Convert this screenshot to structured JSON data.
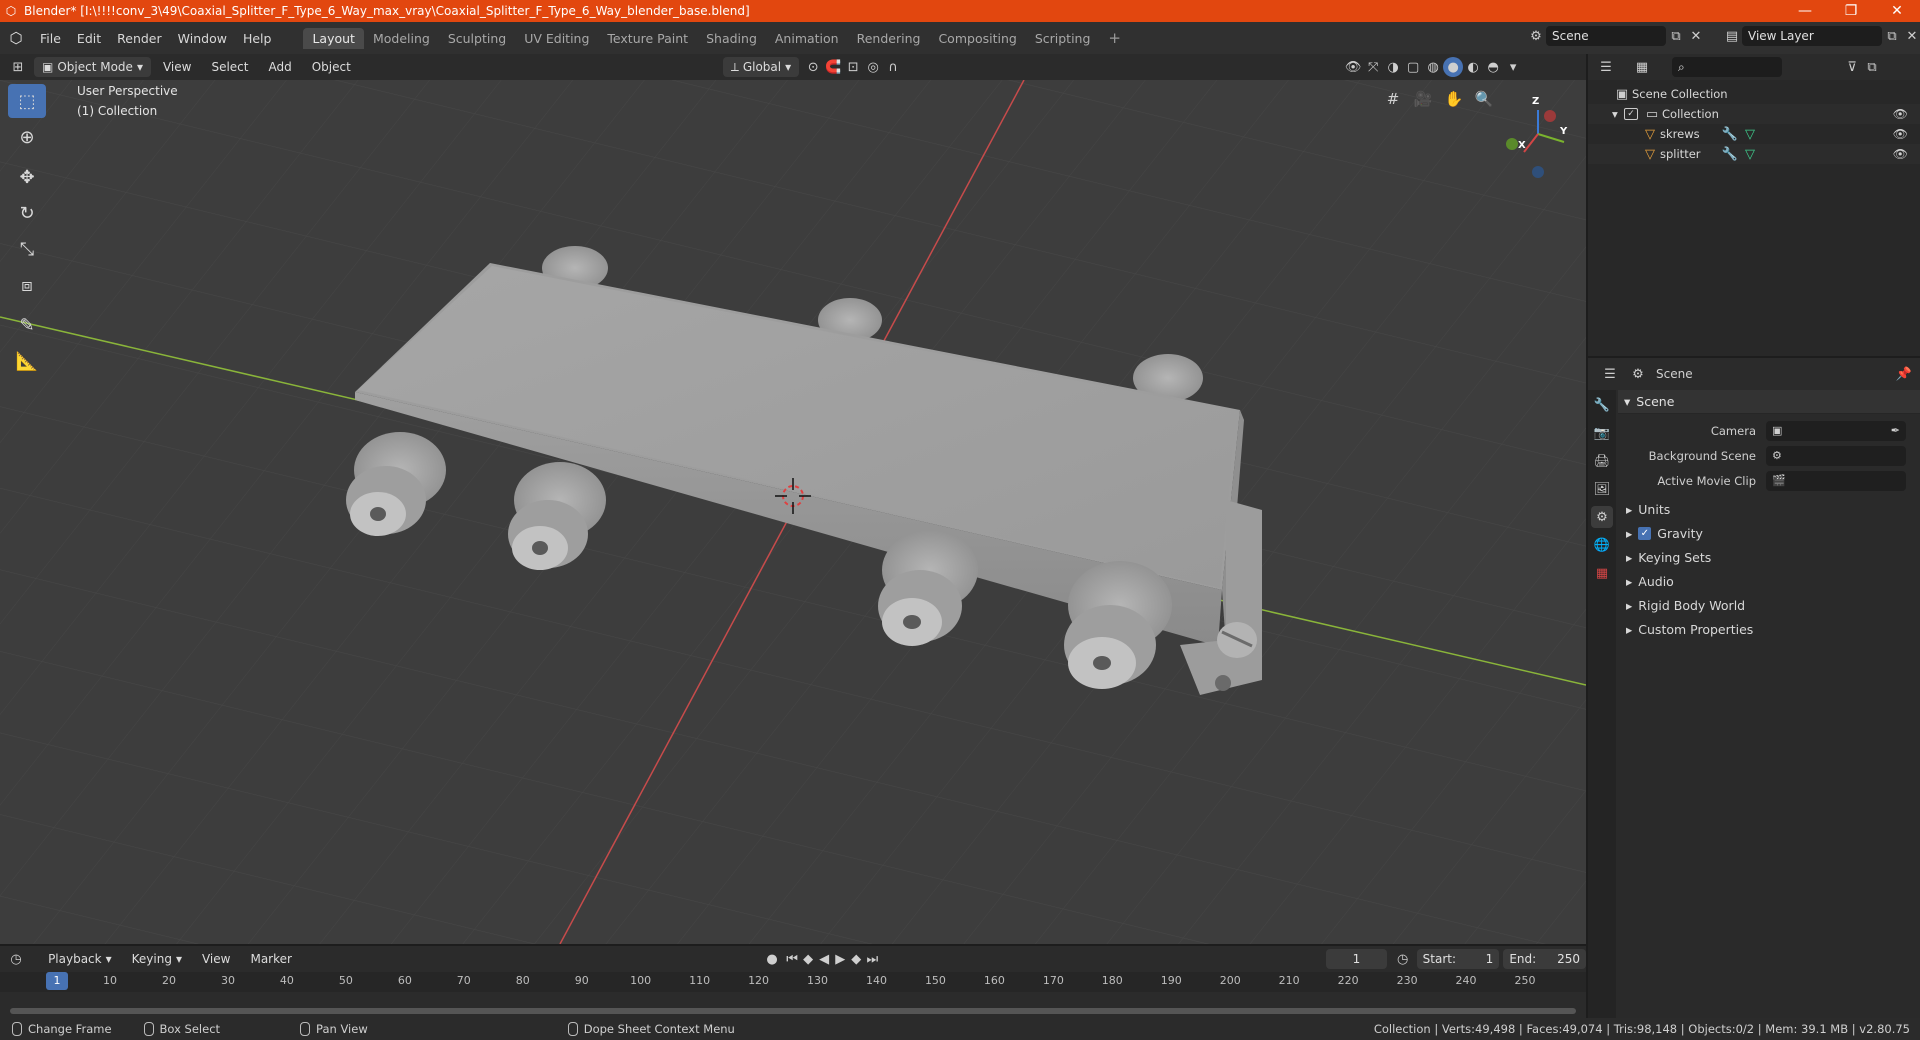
{
  "window": {
    "title": "Blender* [I:\\!!!!conv_3\\49\\Coaxial_Splitter_F_Type_6_Way_max_vray\\Coaxial_Splitter_F_Type_6_Way_blender_base.blend]",
    "minimize": "—",
    "maximize": "❐",
    "close": "✕"
  },
  "menu": [
    "File",
    "Edit",
    "Render",
    "Window",
    "Help"
  ],
  "workspaces": [
    "Layout",
    "Modeling",
    "Sculpting",
    "UV Editing",
    "Texture Paint",
    "Shading",
    "Animation",
    "Rendering",
    "Compositing",
    "Scripting"
  ],
  "workspace_add": "+",
  "scene_selector": {
    "value": "Scene",
    "view_layer": "View Layer"
  },
  "viewport_header": {
    "mode": "Object Mode",
    "menus": [
      "View",
      "Select",
      "Add",
      "Object"
    ],
    "transform_orientation": "Global"
  },
  "viewport": {
    "perspective_label": "User Perspective",
    "collection_label": "(1) Collection",
    "gizmo": {
      "x": "X",
      "y": "Y",
      "z": "Z"
    },
    "colors": {
      "background": "#3d3d3d",
      "x_axis": "#c64b4b",
      "y_axis": "#8ab53a",
      "model": "#9c9c9c"
    }
  },
  "outliner": {
    "root": "Scene Collection",
    "collection": "Collection",
    "objects": [
      "skrews",
      "splitter"
    ]
  },
  "properties": {
    "header_title": "Scene",
    "panel_title": "Scene",
    "rows": [
      {
        "label": "Camera"
      },
      {
        "label": "Background Scene"
      },
      {
        "label": "Active Movie Clip"
      }
    ],
    "subpanels": [
      "Units",
      "Gravity",
      "Keying Sets",
      "Audio",
      "Rigid Body World",
      "Custom Properties"
    ]
  },
  "timeline": {
    "menus": [
      "Playback",
      "Keying",
      "View",
      "Marker"
    ],
    "current_frame": "1",
    "start_label": "Start:",
    "start": "1",
    "end_label": "End:",
    "end": "250",
    "ticks": [
      "10",
      "20",
      "30",
      "40",
      "50",
      "60",
      "70",
      "80",
      "90",
      "100",
      "110",
      "120",
      "130",
      "140",
      "150",
      "160",
      "170",
      "180",
      "190",
      "200",
      "210",
      "220",
      "230",
      "240",
      "250"
    ]
  },
  "status": {
    "change_frame": "Change Frame",
    "box_select": "Box Select",
    "pan_view": "Pan View",
    "context_menu": "Dope Sheet Context Menu",
    "stats": "Collection | Verts:49,498 | Faces:49,074 | Tris:98,148 | Objects:0/2 | Mem: 39.1 MB | v2.80.75"
  }
}
